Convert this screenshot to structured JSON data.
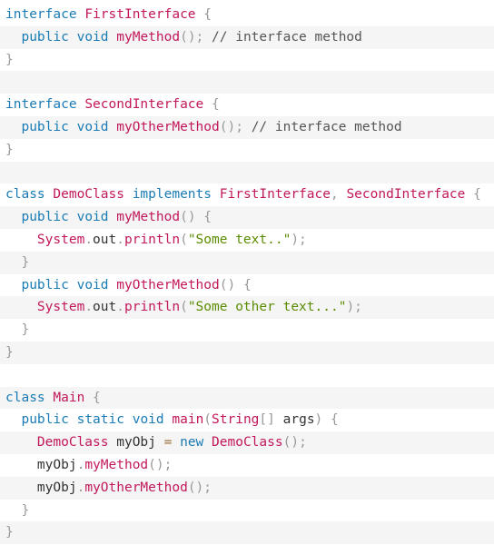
{
  "code": {
    "language": "java",
    "colors": {
      "keyword": "#1a7bb5",
      "class_name": "#c2185b",
      "method": "#c2185b",
      "punctuation": "#999999",
      "comment": "#555555",
      "string": "#5b8c00",
      "plain": "#333333",
      "operator": "#9a6e3a",
      "zebra_background": "#f5f5f5"
    },
    "lines": [
      {
        "zebra": false,
        "tokens": [
          {
            "t": "keyword",
            "v": "interface"
          },
          {
            "t": "space",
            "v": " "
          },
          {
            "t": "class",
            "v": "FirstInterface"
          },
          {
            "t": "space",
            "v": " "
          },
          {
            "t": "punct",
            "v": "{"
          }
        ]
      },
      {
        "zebra": true,
        "tokens": [
          {
            "t": "space",
            "v": "  "
          },
          {
            "t": "keyword",
            "v": "public"
          },
          {
            "t": "space",
            "v": " "
          },
          {
            "t": "keyword",
            "v": "void"
          },
          {
            "t": "space",
            "v": " "
          },
          {
            "t": "method",
            "v": "myMethod"
          },
          {
            "t": "punct",
            "v": "();"
          },
          {
            "t": "space",
            "v": " "
          },
          {
            "t": "comment",
            "v": "// interface method"
          }
        ]
      },
      {
        "zebra": false,
        "tokens": [
          {
            "t": "punct",
            "v": "}"
          }
        ]
      },
      {
        "zebra": true,
        "tokens": []
      },
      {
        "zebra": false,
        "tokens": [
          {
            "t": "keyword",
            "v": "interface"
          },
          {
            "t": "space",
            "v": " "
          },
          {
            "t": "class",
            "v": "SecondInterface"
          },
          {
            "t": "space",
            "v": " "
          },
          {
            "t": "punct",
            "v": "{"
          }
        ]
      },
      {
        "zebra": true,
        "tokens": [
          {
            "t": "space",
            "v": "  "
          },
          {
            "t": "keyword",
            "v": "public"
          },
          {
            "t": "space",
            "v": " "
          },
          {
            "t": "keyword",
            "v": "void"
          },
          {
            "t": "space",
            "v": " "
          },
          {
            "t": "method",
            "v": "myOtherMethod"
          },
          {
            "t": "punct",
            "v": "();"
          },
          {
            "t": "space",
            "v": " "
          },
          {
            "t": "comment",
            "v": "// interface method"
          }
        ]
      },
      {
        "zebra": false,
        "tokens": [
          {
            "t": "punct",
            "v": "}"
          }
        ]
      },
      {
        "zebra": true,
        "tokens": []
      },
      {
        "zebra": false,
        "tokens": [
          {
            "t": "keyword",
            "v": "class"
          },
          {
            "t": "space",
            "v": " "
          },
          {
            "t": "class",
            "v": "DemoClass"
          },
          {
            "t": "space",
            "v": " "
          },
          {
            "t": "keyword",
            "v": "implements"
          },
          {
            "t": "space",
            "v": " "
          },
          {
            "t": "class",
            "v": "FirstInterface"
          },
          {
            "t": "punct",
            "v": ","
          },
          {
            "t": "space",
            "v": " "
          },
          {
            "t": "class",
            "v": "SecondInterface"
          },
          {
            "t": "space",
            "v": " "
          },
          {
            "t": "punct",
            "v": "{"
          }
        ]
      },
      {
        "zebra": true,
        "tokens": [
          {
            "t": "space",
            "v": "  "
          },
          {
            "t": "keyword",
            "v": "public"
          },
          {
            "t": "space",
            "v": " "
          },
          {
            "t": "keyword",
            "v": "void"
          },
          {
            "t": "space",
            "v": " "
          },
          {
            "t": "method",
            "v": "myMethod"
          },
          {
            "t": "punct",
            "v": "()"
          },
          {
            "t": "space",
            "v": " "
          },
          {
            "t": "punct",
            "v": "{"
          }
        ]
      },
      {
        "zebra": false,
        "tokens": [
          {
            "t": "space",
            "v": "    "
          },
          {
            "t": "class",
            "v": "System"
          },
          {
            "t": "punct",
            "v": "."
          },
          {
            "t": "plain",
            "v": "out"
          },
          {
            "t": "punct",
            "v": "."
          },
          {
            "t": "method",
            "v": "println"
          },
          {
            "t": "punct",
            "v": "("
          },
          {
            "t": "string",
            "v": "\"Some text..\""
          },
          {
            "t": "punct",
            "v": ");"
          }
        ]
      },
      {
        "zebra": true,
        "tokens": [
          {
            "t": "space",
            "v": "  "
          },
          {
            "t": "punct",
            "v": "}"
          }
        ]
      },
      {
        "zebra": false,
        "tokens": [
          {
            "t": "space",
            "v": "  "
          },
          {
            "t": "keyword",
            "v": "public"
          },
          {
            "t": "space",
            "v": " "
          },
          {
            "t": "keyword",
            "v": "void"
          },
          {
            "t": "space",
            "v": " "
          },
          {
            "t": "method",
            "v": "myOtherMethod"
          },
          {
            "t": "punct",
            "v": "()"
          },
          {
            "t": "space",
            "v": " "
          },
          {
            "t": "punct",
            "v": "{"
          }
        ]
      },
      {
        "zebra": true,
        "tokens": [
          {
            "t": "space",
            "v": "    "
          },
          {
            "t": "class",
            "v": "System"
          },
          {
            "t": "punct",
            "v": "."
          },
          {
            "t": "plain",
            "v": "out"
          },
          {
            "t": "punct",
            "v": "."
          },
          {
            "t": "method",
            "v": "println"
          },
          {
            "t": "punct",
            "v": "("
          },
          {
            "t": "string",
            "v": "\"Some other text...\""
          },
          {
            "t": "punct",
            "v": ");"
          }
        ]
      },
      {
        "zebra": false,
        "tokens": [
          {
            "t": "space",
            "v": "  "
          },
          {
            "t": "punct",
            "v": "}"
          }
        ]
      },
      {
        "zebra": true,
        "tokens": [
          {
            "t": "punct",
            "v": "}"
          }
        ]
      },
      {
        "zebra": false,
        "tokens": []
      },
      {
        "zebra": true,
        "tokens": [
          {
            "t": "keyword",
            "v": "class"
          },
          {
            "t": "space",
            "v": " "
          },
          {
            "t": "class",
            "v": "Main"
          },
          {
            "t": "space",
            "v": " "
          },
          {
            "t": "punct",
            "v": "{"
          }
        ]
      },
      {
        "zebra": false,
        "tokens": [
          {
            "t": "space",
            "v": "  "
          },
          {
            "t": "keyword",
            "v": "public"
          },
          {
            "t": "space",
            "v": " "
          },
          {
            "t": "keyword",
            "v": "static"
          },
          {
            "t": "space",
            "v": " "
          },
          {
            "t": "keyword",
            "v": "void"
          },
          {
            "t": "space",
            "v": " "
          },
          {
            "t": "method",
            "v": "main"
          },
          {
            "t": "punct",
            "v": "("
          },
          {
            "t": "class",
            "v": "String"
          },
          {
            "t": "punct",
            "v": "[]"
          },
          {
            "t": "space",
            "v": " "
          },
          {
            "t": "plain",
            "v": "args"
          },
          {
            "t": "punct",
            "v": ")"
          },
          {
            "t": "space",
            "v": " "
          },
          {
            "t": "punct",
            "v": "{"
          }
        ]
      },
      {
        "zebra": true,
        "tokens": [
          {
            "t": "space",
            "v": "    "
          },
          {
            "t": "class",
            "v": "DemoClass"
          },
          {
            "t": "space",
            "v": " "
          },
          {
            "t": "plain",
            "v": "myObj"
          },
          {
            "t": "space",
            "v": " "
          },
          {
            "t": "op",
            "v": "="
          },
          {
            "t": "space",
            "v": " "
          },
          {
            "t": "keyword",
            "v": "new"
          },
          {
            "t": "space",
            "v": " "
          },
          {
            "t": "class",
            "v": "DemoClass"
          },
          {
            "t": "punct",
            "v": "();"
          }
        ]
      },
      {
        "zebra": false,
        "tokens": [
          {
            "t": "space",
            "v": "    "
          },
          {
            "t": "plain",
            "v": "myObj"
          },
          {
            "t": "punct",
            "v": "."
          },
          {
            "t": "method",
            "v": "myMethod"
          },
          {
            "t": "punct",
            "v": "();"
          }
        ]
      },
      {
        "zebra": true,
        "tokens": [
          {
            "t": "space",
            "v": "    "
          },
          {
            "t": "plain",
            "v": "myObj"
          },
          {
            "t": "punct",
            "v": "."
          },
          {
            "t": "method",
            "v": "myOtherMethod"
          },
          {
            "t": "punct",
            "v": "();"
          }
        ]
      },
      {
        "zebra": false,
        "tokens": [
          {
            "t": "space",
            "v": "  "
          },
          {
            "t": "punct",
            "v": "}"
          }
        ]
      },
      {
        "zebra": true,
        "tokens": [
          {
            "t": "punct",
            "v": "}"
          }
        ]
      }
    ]
  }
}
